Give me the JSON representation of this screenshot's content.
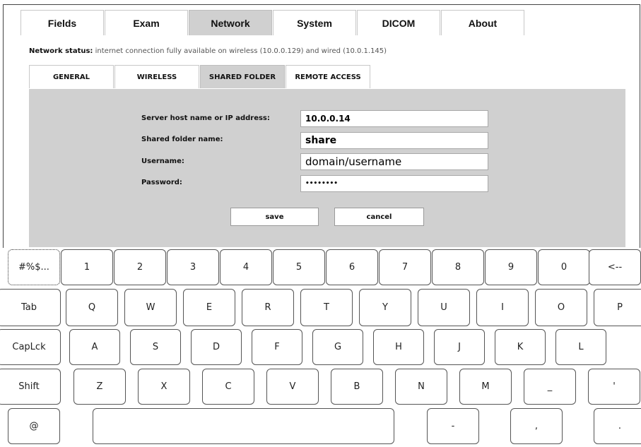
{
  "main_tabs": [
    "Fields",
    "Exam",
    "Network",
    "System",
    "DICOM",
    "About"
  ],
  "active_main_tab": "Network",
  "status": {
    "label": "Network status:",
    "text": "internet connection fully available on wireless (10.0.0.129) and wired (10.0.1.145)"
  },
  "sub_tabs": [
    "GENERAL",
    "WIRELESS",
    "SHARED FOLDER",
    "REMOTE ACCESS"
  ],
  "active_sub_tab": "SHARED FOLDER",
  "form": {
    "host_label": "Server host name or IP address:",
    "host_value": "10.0.0.14",
    "folder_label": "Shared folder name:",
    "folder_value": "share",
    "username_label": "Username:",
    "username_value": "domain/username",
    "password_label": "Password:",
    "password_value": "••••••••"
  },
  "buttons": {
    "save": "save",
    "cancel": "cancel"
  },
  "keyboard": {
    "row1": [
      "#%$...",
      "1",
      "2",
      "3",
      "4",
      "5",
      "6",
      "7",
      "8",
      "9",
      "0",
      "<--"
    ],
    "row2": [
      "Tab",
      "Q",
      "W",
      "E",
      "R",
      "T",
      "Y",
      "U",
      "I",
      "O",
      "P"
    ],
    "row3": [
      "CapLck",
      "A",
      "S",
      "D",
      "F",
      "G",
      "H",
      "J",
      "K",
      "L"
    ],
    "row4": [
      "Shift",
      "Z",
      "X",
      "C",
      "V",
      "B",
      "N",
      "M",
      "_",
      "'"
    ],
    "row5": [
      "@",
      "",
      "-",
      ",",
      "."
    ]
  }
}
